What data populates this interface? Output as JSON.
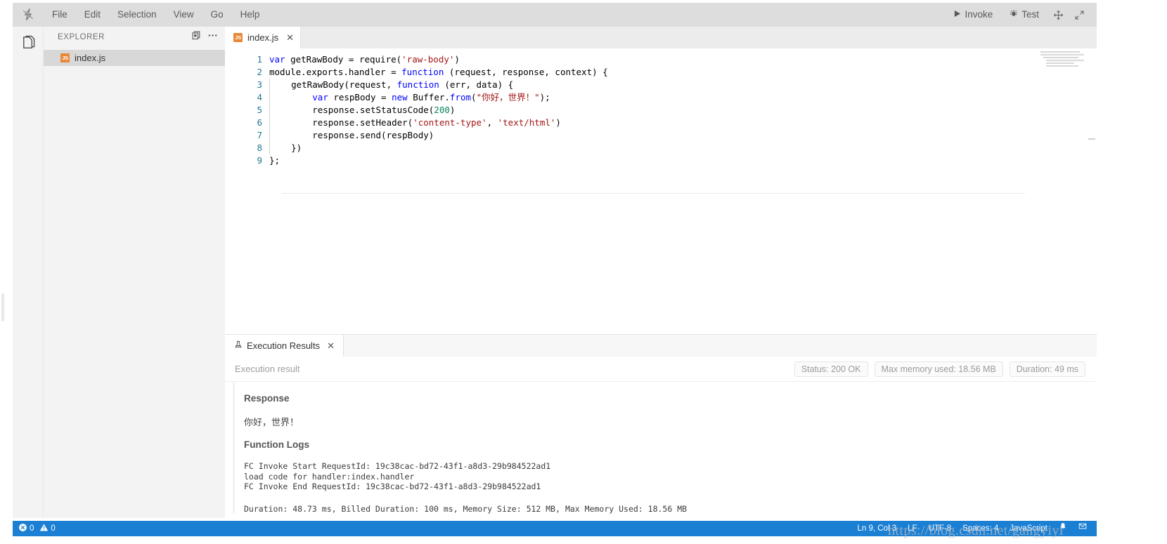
{
  "window": {
    "logo_icon": "fc-logo-icon"
  },
  "menubar": {
    "items": [
      {
        "label": "File"
      },
      {
        "label": "Edit"
      },
      {
        "label": "Selection"
      },
      {
        "label": "View"
      },
      {
        "label": "Go"
      },
      {
        "label": "Help"
      }
    ],
    "actions": [
      {
        "label": "Invoke",
        "icon": "play-icon"
      },
      {
        "label": "Test",
        "icon": "bug-icon"
      }
    ],
    "window_icons": [
      {
        "icon": "move-icon"
      },
      {
        "icon": "expand-icon"
      }
    ]
  },
  "activitybar": {
    "items": [
      {
        "icon": "files-explorer-icon",
        "active": true
      }
    ]
  },
  "sidebar": {
    "title": "EXPLORER",
    "header_actions": [
      {
        "icon": "new-file-icon"
      },
      {
        "icon": "more-actions-icon"
      }
    ],
    "files": [
      {
        "name": "index.js",
        "badge": "JS",
        "badge_color": "#e8883a",
        "selected": true
      }
    ]
  },
  "editor": {
    "tabs": [
      {
        "label": "index.js",
        "badge": "JS",
        "close_icon": "close-icon",
        "active": true
      }
    ],
    "code_lines": [
      {
        "number": "1",
        "indent": 0,
        "tokens": [
          {
            "t": "var ",
            "c": "kw"
          },
          {
            "t": "getRawBody = require(",
            "c": "plain"
          },
          {
            "t": "'raw-body'",
            "c": "str"
          },
          {
            "t": ")",
            "c": "plain"
          }
        ]
      },
      {
        "number": "2",
        "indent": 0,
        "tokens": [
          {
            "t": "module.exports.handler = ",
            "c": "plain"
          },
          {
            "t": "function",
            "c": "kw"
          },
          {
            "t": " (request, response, context) {",
            "c": "plain"
          }
        ]
      },
      {
        "number": "3",
        "indent": 1,
        "tokens": [
          {
            "t": "    getRawBody(request, ",
            "c": "plain"
          },
          {
            "t": "function",
            "c": "kw"
          },
          {
            "t": " (err, data) {",
            "c": "plain"
          }
        ]
      },
      {
        "number": "4",
        "indent": 1,
        "tokens": [
          {
            "t": "        ",
            "c": "plain"
          },
          {
            "t": "var ",
            "c": "kw"
          },
          {
            "t": "respBody = ",
            "c": "plain"
          },
          {
            "t": "new ",
            "c": "kw"
          },
          {
            "t": "Buffer.",
            "c": "plain"
          },
          {
            "t": "from",
            "c": "kw"
          },
          {
            "t": "(",
            "c": "plain"
          },
          {
            "t": "\"你好，世界！\"",
            "c": "str"
          },
          {
            "t": ");",
            "c": "plain"
          }
        ]
      },
      {
        "number": "5",
        "indent": 1,
        "tokens": [
          {
            "t": "        response.setStatusCode(",
            "c": "plain"
          },
          {
            "t": "200",
            "c": "num"
          },
          {
            "t": ")",
            "c": "plain"
          }
        ]
      },
      {
        "number": "6",
        "indent": 1,
        "tokens": [
          {
            "t": "        response.setHeader(",
            "c": "plain"
          },
          {
            "t": "'content-type'",
            "c": "str"
          },
          {
            "t": ", ",
            "c": "plain"
          },
          {
            "t": "'text/html'",
            "c": "str"
          },
          {
            "t": ")",
            "c": "plain"
          }
        ]
      },
      {
        "number": "7",
        "indent": 1,
        "tokens": [
          {
            "t": "        response.send(respBody)",
            "c": "plain"
          }
        ]
      },
      {
        "number": "8",
        "indent": 1,
        "tokens": [
          {
            "t": "    })",
            "c": "plain"
          }
        ]
      },
      {
        "number": "9",
        "indent": 0,
        "tokens": [
          {
            "t": "};",
            "c": "plain"
          }
        ]
      }
    ]
  },
  "panel": {
    "tabs": [
      {
        "label": "Execution Results",
        "icon": "flask-icon",
        "close_icon": "close-icon",
        "active": true
      }
    ],
    "result_header": {
      "title": "Execution result",
      "badges": [
        {
          "label": "Status: 200 OK"
        },
        {
          "label": "Max memory used: 18.56 MB"
        },
        {
          "label": "Duration: 49 ms"
        }
      ]
    },
    "response": {
      "heading": "Response",
      "body": "你好，世界！"
    },
    "function_logs": {
      "heading": "Function Logs",
      "lines": [
        "FC Invoke Start RequestId: 19c38cac-bd72-43f1-a8d3-29b984522ad1",
        "load code for handler:index.handler",
        "FC Invoke End RequestId: 19c38cac-bd72-43f1-a8d3-29b984522ad1"
      ],
      "summary": "Duration: 48.73 ms, Billed Duration: 100 ms, Memory Size: 512 MB, Max Memory Used: 18.56 MB"
    }
  },
  "statusbar": {
    "errors": "0",
    "warnings": "0",
    "error_icon": "error-circle-icon",
    "warning_icon": "warning-triangle-icon",
    "right_items": [
      {
        "label": "Ln 9, Col 3"
      },
      {
        "label": "LF"
      },
      {
        "label": "UTF-8"
      },
      {
        "label": "Spaces: 4"
      },
      {
        "label": "JavaScript"
      }
    ],
    "right_icons": [
      {
        "icon": "bell-icon"
      },
      {
        "icon": "feedback-icon"
      }
    ],
    "accent_color": "#1b7fd4"
  },
  "watermark": {
    "text": "https://blog.csdn.net/gangyiyi"
  }
}
